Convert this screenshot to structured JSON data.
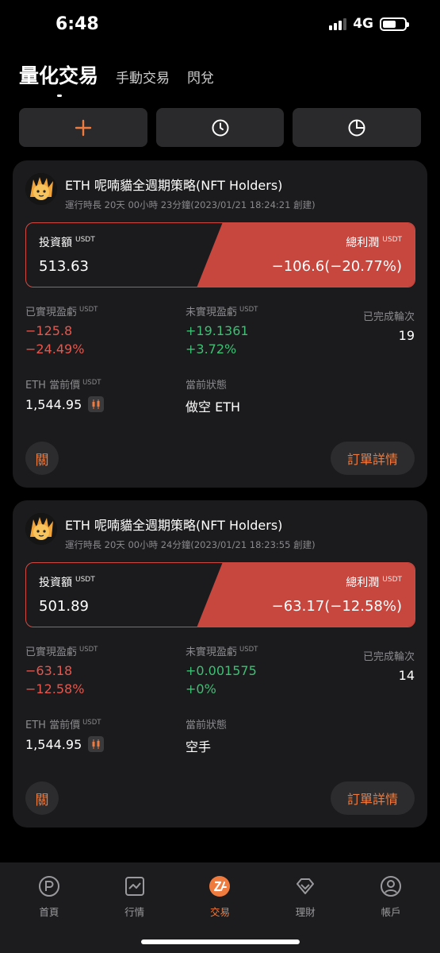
{
  "status_bar": {
    "time": "6:48",
    "network": "4G"
  },
  "tabs": [
    {
      "label": "量化交易",
      "active": true
    },
    {
      "label": "手動交易",
      "active": false
    },
    {
      "label": "閃兌",
      "active": false
    }
  ],
  "action_buttons": [
    {
      "icon": "plus-icon"
    },
    {
      "icon": "clock-icon"
    },
    {
      "icon": "pie-chart-icon"
    }
  ],
  "labels": {
    "invest": "投資額",
    "total_profit": "總利潤",
    "unit": "USDT",
    "realized": "已實現盈虧",
    "unrealized": "未實現盈虧",
    "completed_rounds": "已完成輪次",
    "current_price": "ETH 當前價",
    "current_state": "當前狀態",
    "close": "關",
    "order_detail": "訂單詳情"
  },
  "strategies": [
    {
      "title": "ETH 呢喃貓全週期策略(NFT Holders)",
      "subtitle": "運行時長 20天 00小時 23分鐘(2023/01/21 18:24:21 創建)",
      "invest": "513.63",
      "total_profit": "−106.6(−20.77%)",
      "realized_amount": "−125.8",
      "realized_pct": "−24.49%",
      "unrealized_amount": "+19.1361",
      "unrealized_pct": "+3.72%",
      "completed_rounds": "19",
      "current_price": "1,544.95",
      "current_state": "做空 ETH"
    },
    {
      "title": "ETH 呢喃貓全週期策略(NFT Holders)",
      "subtitle": "運行時長 20天 00小時 24分鐘(2023/01/21 18:23:55 創建)",
      "invest": "501.89",
      "total_profit": "−63.17(−12.58%)",
      "realized_amount": "−63.18",
      "realized_pct": "−12.58%",
      "unrealized_amount": "+0.001575",
      "unrealized_pct": "+0%",
      "completed_rounds": "14",
      "current_price": "1,544.95",
      "current_state": "空手"
    }
  ],
  "bottom_nav": [
    {
      "label": "首頁",
      "icon": "home-p-icon",
      "active": false
    },
    {
      "label": "行情",
      "icon": "market-chart-icon",
      "active": false
    },
    {
      "label": "交易",
      "icon": "trade-icon",
      "active": true
    },
    {
      "label": "理財",
      "icon": "diamond-icon",
      "active": false
    },
    {
      "label": "帳戶",
      "icon": "user-icon",
      "active": false
    }
  ],
  "colors": {
    "accent": "#f07b3f",
    "loss": "#e5574d",
    "gain": "#3fbf74",
    "banner": "#c7473f"
  }
}
